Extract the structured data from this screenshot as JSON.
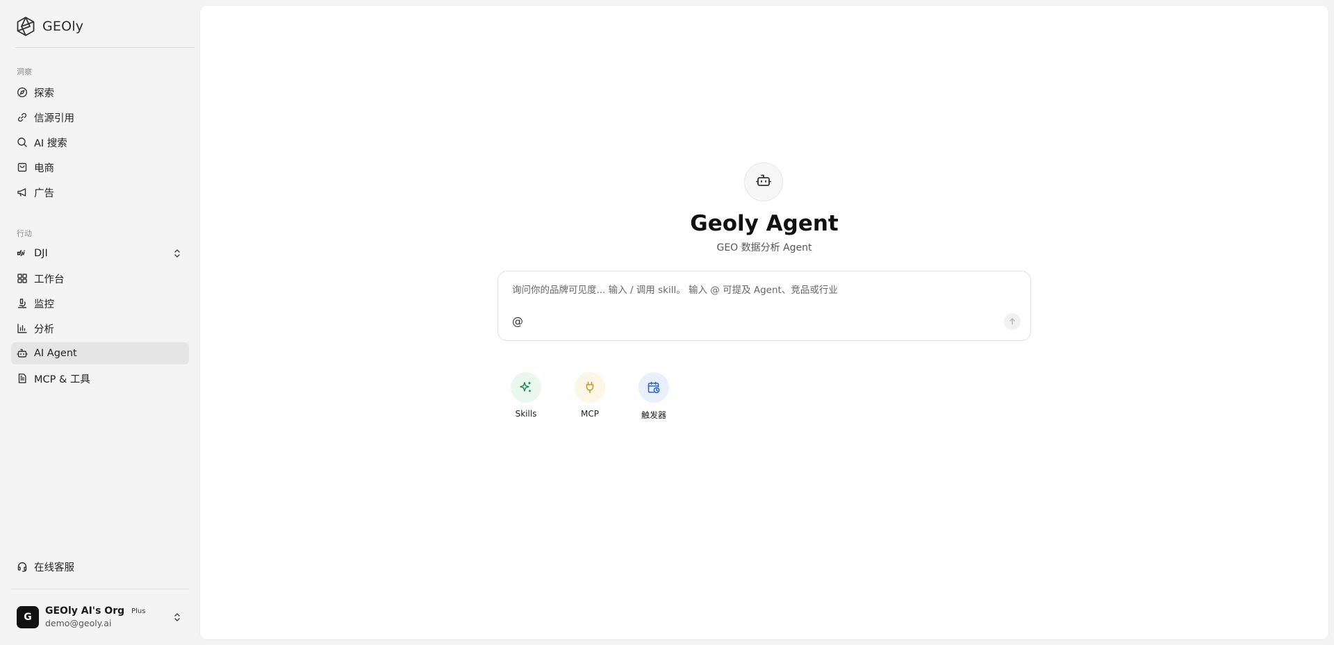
{
  "brand": {
    "name": "GEOly"
  },
  "sidebar": {
    "insight_label": "洞察",
    "insight_items": [
      {
        "label": "探索",
        "icon": "compass-icon"
      },
      {
        "label": "信源引用",
        "icon": "link-icon"
      },
      {
        "label": "AI 搜索",
        "icon": "search-icon"
      },
      {
        "label": "电商",
        "icon": "shopping-bag-icon"
      },
      {
        "label": "广告",
        "icon": "megaphone-icon"
      }
    ],
    "action_label": "行动",
    "brand_switch": {
      "label": "DJI",
      "icon": "dji-logo-icon"
    },
    "action_items": [
      {
        "label": "工作台",
        "icon": "grid-icon"
      },
      {
        "label": "监控",
        "icon": "microscope-icon"
      },
      {
        "label": "分析",
        "icon": "bar-chart-icon"
      },
      {
        "label": "AI Agent",
        "icon": "bot-icon",
        "active": true
      },
      {
        "label": "MCP & 工具",
        "icon": "file-text-icon"
      }
    ],
    "support": {
      "label": "在线客服",
      "icon": "headset-icon"
    }
  },
  "org": {
    "avatar_letter": "G",
    "name": "GEOly AI's Org",
    "plan": "Plus",
    "email": "demo@geoly.ai"
  },
  "main": {
    "title": "Geoly Agent",
    "subtitle": "GEO 数据分析 Agent",
    "composer": {
      "placeholder": "询问你的品牌可见度... 输入 / 调用 skill。 输入 @ 可提及 Agent、竞品或行业",
      "at_symbol": "@"
    },
    "quick_actions": [
      {
        "label": "Skills",
        "icon": "sparkles-icon",
        "color": "#2f8f5b",
        "bg": "#eaf7ef"
      },
      {
        "label": "MCP",
        "icon": "plug-icon",
        "color": "#c9962b",
        "bg": "#fbf6e6"
      },
      {
        "label": "触发器",
        "icon": "calendar-clock-icon",
        "color": "#2b63c9",
        "bg": "#e9f0fb"
      }
    ]
  }
}
